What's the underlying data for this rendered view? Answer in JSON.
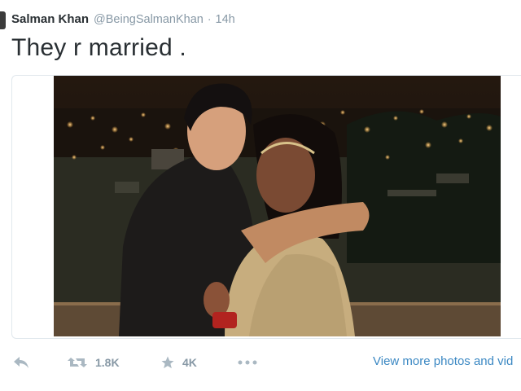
{
  "tweet": {
    "display_name": "Salman Khan",
    "screen_name": "@BeingSalmanKhan",
    "separator": "·",
    "time": "14h",
    "text": "They r married ."
  },
  "actions": {
    "reply_icon": "reply-icon",
    "retweet_icon": "retweet-icon",
    "retweet_count": "1.8K",
    "favorite_icon": "star-icon",
    "favorite_count": "4K",
    "more_icon": "more-dots-icon"
  },
  "media": {
    "view_more_label": "View more photos and vid"
  },
  "colors": {
    "text": "#292f33",
    "muted": "#8899a6",
    "icon": "#aab8c2",
    "link": "#3b88c3",
    "border": "#e1e8ed"
  }
}
